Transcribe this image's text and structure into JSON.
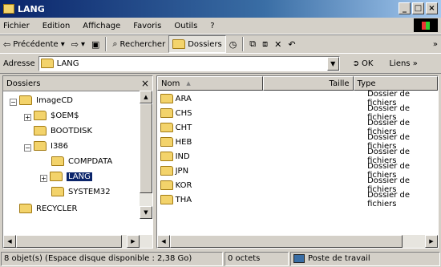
{
  "window": {
    "title": "LANG"
  },
  "menu": [
    "Fichier",
    "Edition",
    "Affichage",
    "Favoris",
    "Outils",
    "?"
  ],
  "toolbar": {
    "back_label": "Précédente",
    "search_label": "Rechercher",
    "folders_label": "Dossiers",
    "more": "»"
  },
  "address": {
    "label": "Adresse",
    "value": "LANG",
    "go_label": "OK",
    "links_label": "Liens »"
  },
  "left_panel": {
    "title": "Dossiers",
    "close": "×",
    "tree": [
      {
        "label": "ImageCD",
        "expander": "−"
      },
      {
        "label": "$OEM$",
        "expander": "+"
      },
      {
        "label": "BOOTDISK",
        "expander": ""
      },
      {
        "label": "I386",
        "expander": "−"
      },
      {
        "label": "COMPDATA",
        "expander": ""
      },
      {
        "label": "LANG",
        "expander": "+",
        "selected": true
      },
      {
        "label": "SYSTEM32",
        "expander": ""
      },
      {
        "label": "RECYCLER",
        "expander": ""
      }
    ]
  },
  "file_list": {
    "columns": [
      "Nom",
      "Taille",
      "Type"
    ],
    "rows": [
      {
        "name": "ARA",
        "type": "Dossier de fichiers"
      },
      {
        "name": "CHS",
        "type": "Dossier de fichiers"
      },
      {
        "name": "CHT",
        "type": "Dossier de fichiers"
      },
      {
        "name": "HEB",
        "type": "Dossier de fichiers"
      },
      {
        "name": "IND",
        "type": "Dossier de fichiers"
      },
      {
        "name": "JPN",
        "type": "Dossier de fichiers"
      },
      {
        "name": "KOR",
        "type": "Dossier de fichiers"
      },
      {
        "name": "THA",
        "type": "Dossier de fichiers"
      }
    ]
  },
  "status": {
    "objects": "8 objet(s) (Espace disque disponible : 2,38 Go)",
    "size": "0 octets",
    "location": "Poste de travail"
  },
  "colors": {
    "title_active": "#0a246a",
    "selection": "#0a246a",
    "folder": "#f3d36b",
    "chrome": "#d4d0c8"
  },
  "icons": [
    "folder-icon",
    "back-arrow-icon",
    "forward-arrow-icon",
    "up-folder-icon",
    "search-icon",
    "folders-icon",
    "history-icon",
    "move-to-icon",
    "copy-to-icon",
    "delete-icon",
    "undo-icon",
    "go-arrow-icon",
    "computer-icon"
  ]
}
